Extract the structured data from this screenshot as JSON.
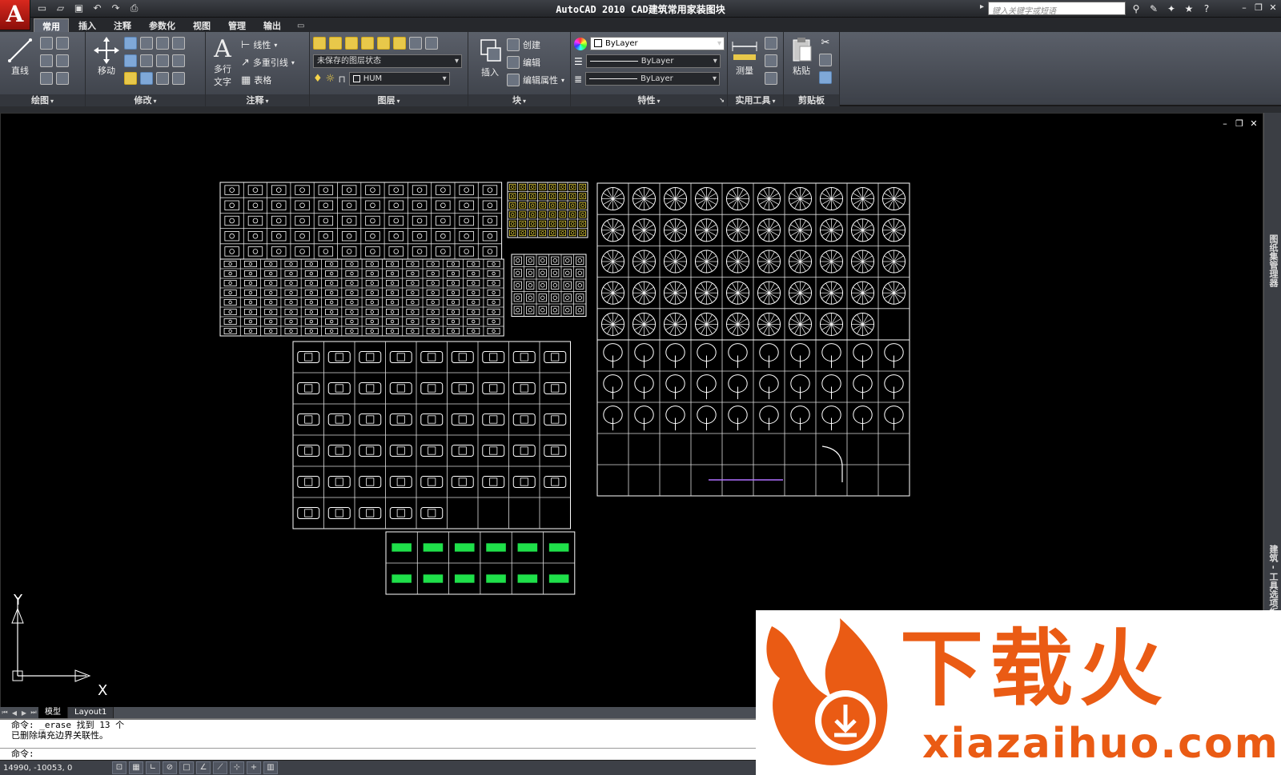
{
  "app": {
    "logo_letter": "A",
    "title": "AutoCAD 2010  CAD建筑常用家装图块",
    "search_placeholder": "键入关键字或短语"
  },
  "qat": [
    "new-icon",
    "open-icon",
    "save-icon",
    "undo-icon",
    "redo-icon",
    "print-icon"
  ],
  "ribbon_tabs": [
    "常用",
    "插入",
    "注释",
    "参数化",
    "视图",
    "管理",
    "输出"
  ],
  "active_tab": "常用",
  "panels": {
    "draw": {
      "title": "绘图",
      "line": "直线"
    },
    "modify": {
      "title": "修改",
      "move": "移动"
    },
    "annotation": {
      "title": "注释",
      "mtext_line1": "多行",
      "mtext_line2": "文字",
      "linear": "线性",
      "multileader": "多重引线",
      "table": "表格"
    },
    "layers": {
      "title": "图层",
      "layer_state": "未保存的图层状态",
      "current_layer": "HUM"
    },
    "block": {
      "title": "块",
      "insert": "插入",
      "create": "创建",
      "edit": "编辑",
      "edit_attr": "编辑属性"
    },
    "properties": {
      "title": "特性",
      "color": "ByLayer",
      "linetype": "ByLayer",
      "lineweight": "ByLayer"
    },
    "utilities": {
      "title": "实用工具",
      "measure": "测量"
    },
    "clipboard": {
      "title": "剪贴板",
      "paste": "粘贴"
    }
  },
  "right_palette": {
    "label_top": "图纸集管理器",
    "label_bottom": "建筑 - 工具选项板"
  },
  "ucs": {
    "y": "Y",
    "x": "X"
  },
  "layout_tabs": [
    "模型",
    "Layout1"
  ],
  "active_layout": "模型",
  "command_lines": [
    "命令: _erase 找到 13 个",
    "已删除填充边界关联性。",
    "命令:"
  ],
  "coordinates": "14990, -10053, 0",
  "watermark": {
    "cn": "下载火",
    "en": "xiazaihuo.com"
  },
  "colors": {
    "accent": "#ea5b14",
    "model_bg": "#000000",
    "ribbon": "#4b5058"
  }
}
